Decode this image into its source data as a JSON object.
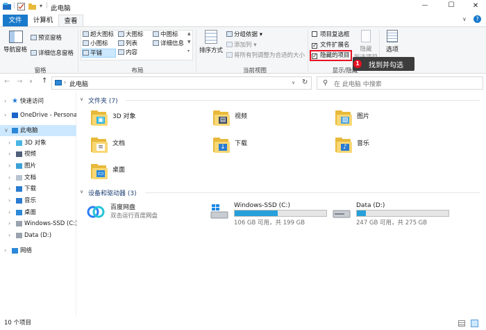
{
  "window": {
    "title": "此电脑",
    "minimize": "—",
    "maximize": "☐",
    "close": "✕"
  },
  "tabs": {
    "file": "文件",
    "computer": "计算机",
    "view": "查看"
  },
  "ribbon": {
    "pane_group": {
      "nav_pane": "导航窗格",
      "preview_pane": "预览窗格",
      "details_pane": "详细信息窗格",
      "label": "窗格"
    },
    "layout_group": {
      "extra_large": "超大图标",
      "large": "大图标",
      "medium": "中图标",
      "small": "小图标",
      "list": "列表",
      "details": "详细信息",
      "tiles": "平铺",
      "content": "内容",
      "label": "布局"
    },
    "current_view_group": {
      "sort": "排序方式",
      "group_by": "分组依据",
      "add_column": "添加列",
      "fit_columns": "将所有列调整为合适的大小",
      "label": "当前视图"
    },
    "show_hide_group": {
      "item_checkboxes": "项目复选框",
      "file_extensions": "文件扩展名",
      "hidden_items": "隐藏的项目",
      "hide_selected": "隐藏",
      "hide_selected2": "所选项目",
      "label": "显示/隐藏"
    },
    "options": "选项",
    "callout": {
      "badge": "1",
      "text": "找到并勾选"
    },
    "checks": {
      "item_checkboxes": false,
      "file_extensions": true,
      "hidden_items": true
    }
  },
  "address": {
    "back": "←",
    "forward": "→",
    "recent": "∨",
    "up": "↑",
    "path": "此电脑",
    "refresh": "↻",
    "search_placeholder": "在 此电脑 中搜索",
    "dropdown": "∨"
  },
  "nav": {
    "items": [
      {
        "label": "快速访问",
        "icon": "star-icon"
      },
      {
        "label": "OneDrive - Persona",
        "icon": "cloud-icon"
      },
      {
        "label": "此电脑",
        "icon": "computer-icon"
      },
      {
        "label": "3D 对象",
        "icon": "cube-icon"
      },
      {
        "label": "视频",
        "icon": "video-icon"
      },
      {
        "label": "图片",
        "icon": "picture-icon"
      },
      {
        "label": "文档",
        "icon": "document-icon"
      },
      {
        "label": "下载",
        "icon": "download-icon"
      },
      {
        "label": "音乐",
        "icon": "music-icon"
      },
      {
        "label": "桌面",
        "icon": "desktop-icon"
      },
      {
        "label": "Windows-SSD (C:)",
        "icon": "drive-icon"
      },
      {
        "label": "Data (D:)",
        "icon": "drive-icon"
      },
      {
        "label": "网络",
        "icon": "network-icon"
      }
    ]
  },
  "main": {
    "folders_header": "文件夹 (7)",
    "folders": [
      {
        "name": "3D 对象",
        "icon": "cube-icon"
      },
      {
        "name": "视频",
        "icon": "video-icon"
      },
      {
        "name": "图片",
        "icon": "picture-icon"
      },
      {
        "name": "文档",
        "icon": "document-icon"
      },
      {
        "name": "下载",
        "icon": "download-icon"
      },
      {
        "name": "音乐",
        "icon": "music-icon"
      },
      {
        "name": "桌面",
        "icon": "desktop-icon"
      }
    ],
    "devices_header": "设备和驱动器 (3)",
    "devices": [
      {
        "name": "百度网盘",
        "sub": "双击运行百度网盘",
        "icon": "baidu-netdisk-icon"
      },
      {
        "name": "Windows-SSD (C:)",
        "sub": "106 GB 可用，共 199 GB",
        "used_fraction": 0.47,
        "icon": "windows-drive-icon"
      },
      {
        "name": "Data (D:)",
        "sub": "247 GB 可用，共 275 GB",
        "used_fraction": 0.1,
        "icon": "drive-icon"
      }
    ]
  },
  "status": {
    "count": "10 个项目"
  },
  "colors": {
    "accent": "#1979ca",
    "highlight": "#cce8ff",
    "callout_bg": "#3c3c3c",
    "callout_badge": "#e81123",
    "folder": "#f8d775",
    "drive_fill": "#26a0da"
  }
}
